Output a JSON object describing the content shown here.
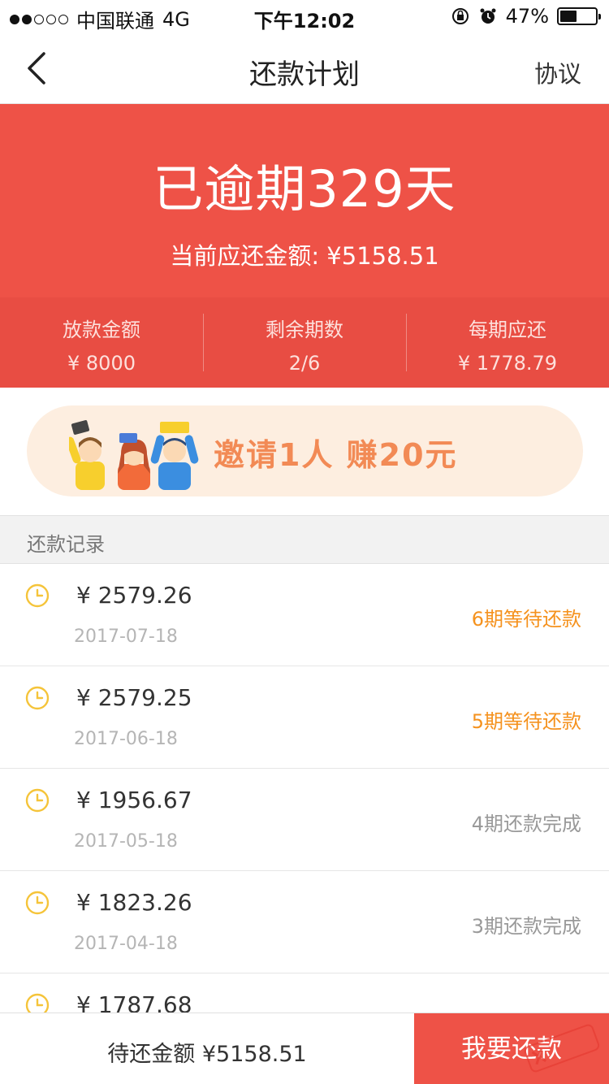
{
  "status_bar": {
    "carrier": "中国联通",
    "network": "4G",
    "time": "下午12:02",
    "battery": "47%",
    "battery_level": 0.47
  },
  "nav": {
    "title": "还款计划",
    "right_label": "协议",
    "back_icon": "chevron-left-icon"
  },
  "hero": {
    "overdue_text": "已逾期329天",
    "current_due_text": "当前应还金额: ¥5158.51",
    "background": "#ee5247"
  },
  "stats": [
    {
      "label": "放款金额",
      "value": "¥ 8000"
    },
    {
      "label": "剩余期数",
      "value": "2/6"
    },
    {
      "label": "每期应还",
      "value": "¥ 1778.79"
    }
  ],
  "banner": {
    "text": "邀请1人 赚20元",
    "art_icon": "invite-friends-illustration"
  },
  "records_section": {
    "title": "还款记录"
  },
  "records": [
    {
      "amount": "¥  2579.26",
      "date": "2017-07-18",
      "status": "6期等待还款",
      "state": "pending"
    },
    {
      "amount": "¥  2579.25",
      "date": "2017-06-18",
      "status": "5期等待还款",
      "state": "pending"
    },
    {
      "amount": "¥  1956.67",
      "date": "2017-05-18",
      "status": "4期还款完成",
      "state": "done"
    },
    {
      "amount": "¥  1823.26",
      "date": "2017-04-18",
      "status": "3期还款完成",
      "state": "done"
    },
    {
      "amount": "¥  1787.68",
      "date": "",
      "status": "",
      "state": "done"
    }
  ],
  "bottom": {
    "due_text": "待还金额 ¥5158.51",
    "button_label": "我要还款"
  },
  "colors": {
    "primary_red": "#ee5247",
    "pending_orange": "#f5921e",
    "clock_yellow": "#f5c43a"
  }
}
